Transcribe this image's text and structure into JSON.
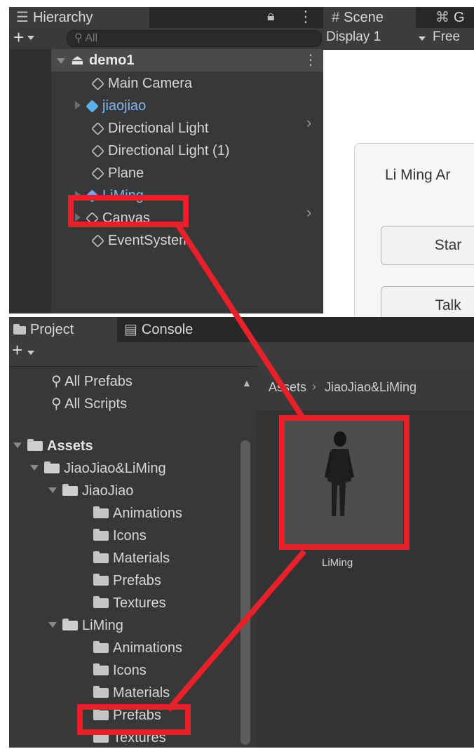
{
  "hierarchy": {
    "tab_label": "Hierarchy",
    "search_placeholder": "All",
    "scene_name": "demo1",
    "items": [
      {
        "label": "Main Camera"
      },
      {
        "label": "jiaojiao"
      },
      {
        "label": "Directional Light"
      },
      {
        "label": "Directional Light (1)"
      },
      {
        "label": "Plane"
      },
      {
        "label": "LiMing"
      },
      {
        "label": "Canvas"
      },
      {
        "label": "EventSystem"
      }
    ]
  },
  "scene": {
    "tab_scene": "Scene",
    "tab_game": "G",
    "display_select": "Display 1",
    "aspect_select": "Free",
    "ui_title": "Li Ming Ar",
    "button1": "Star",
    "button2": "Talk"
  },
  "project": {
    "tab_project": "Project",
    "tab_console": "Console",
    "favorites": [
      "All Prefabs",
      "All Scripts"
    ],
    "tree": {
      "assets": "Assets",
      "jiaojiao_liming": "JiaoJiao&LiMing",
      "jiaojiao": "JiaoJiao",
      "jiaojiao_children": [
        "Animations",
        "Icons",
        "Materials",
        "Prefabs",
        "Textures"
      ],
      "liming": "LiMing",
      "liming_children": [
        "Animations",
        "Icons",
        "Materials",
        "Prefabs",
        "Textures"
      ]
    },
    "breadcrumb": [
      "Assets",
      "JiaoJiao&LiMing"
    ],
    "asset_label": "LiMing"
  },
  "colors": {
    "annotation_red": "#e8202a",
    "prefab_blue": "#5ab1ea",
    "selected_text_blue": "#7fb6f2"
  }
}
